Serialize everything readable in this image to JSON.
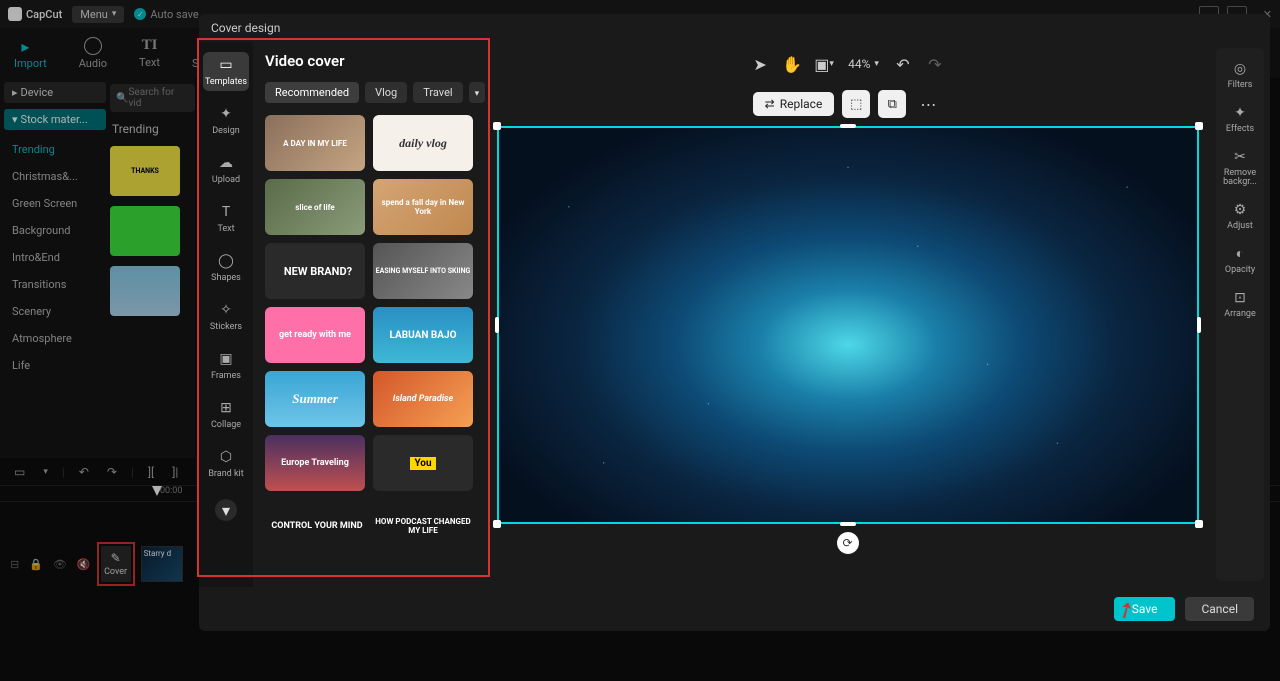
{
  "app": {
    "name": "CapCut",
    "menu": "Menu",
    "autosave": "Auto save"
  },
  "tooltabs": {
    "import": "Import",
    "audio": "Audio",
    "text": "Text",
    "stickers": "Stickers"
  },
  "leftpanel": {
    "device": "Device",
    "stock": "Stock mater...",
    "search_placeholder": "Search for vid",
    "trending_heading": "Trending",
    "thanks_thumb": "THANKS",
    "cats": [
      "Trending",
      "Christmas&...",
      "Green Screen",
      "Background",
      "Intro&End",
      "Transitions",
      "Scenery",
      "Atmosphere",
      "Life"
    ]
  },
  "timeline": {
    "time": "00:00",
    "cover_label": "Cover",
    "clip_label": "Starry d"
  },
  "cover": {
    "title": "Cover design",
    "sidebar": {
      "templates": "Templates",
      "design": "Design",
      "upload": "Upload",
      "text": "Text",
      "shapes": "Shapes",
      "stickers": "Stickers",
      "frames": "Frames",
      "collage": "Collage",
      "brandkit": "Brand kit"
    },
    "templates": {
      "heading": "Video cover",
      "tabs": {
        "recommended": "Recommended",
        "vlog": "Vlog",
        "travel": "Travel"
      },
      "items": {
        "t1": "A DAY IN MY LIFE",
        "t2": "daily vlog",
        "t3": "slice of life",
        "t4": "spend a fall day in New York",
        "t5": "NEW\nBRAND?",
        "t6": "EASING MYSELF INTO SKIING",
        "t7": "get ready with me",
        "t8": "LABUAN BAJO",
        "t9": "Summer",
        "t10": "Island Paradise",
        "t11": "Europe Traveling",
        "t12": "You",
        "t13": "CONTROL\nYOUR\nMIND",
        "t14": "HOW PODCAST CHANGED MY LIFE"
      }
    },
    "toolbar": {
      "zoom": "44%"
    },
    "actions": {
      "replace": "Replace"
    },
    "rightbar": {
      "filters": "Filters",
      "effects": "Effects",
      "remove": "Remove backgr...",
      "adjust": "Adjust",
      "opacity": "Opacity",
      "arrange": "Arrange"
    },
    "footer": {
      "save": "Save",
      "cancel": "Cancel"
    }
  }
}
